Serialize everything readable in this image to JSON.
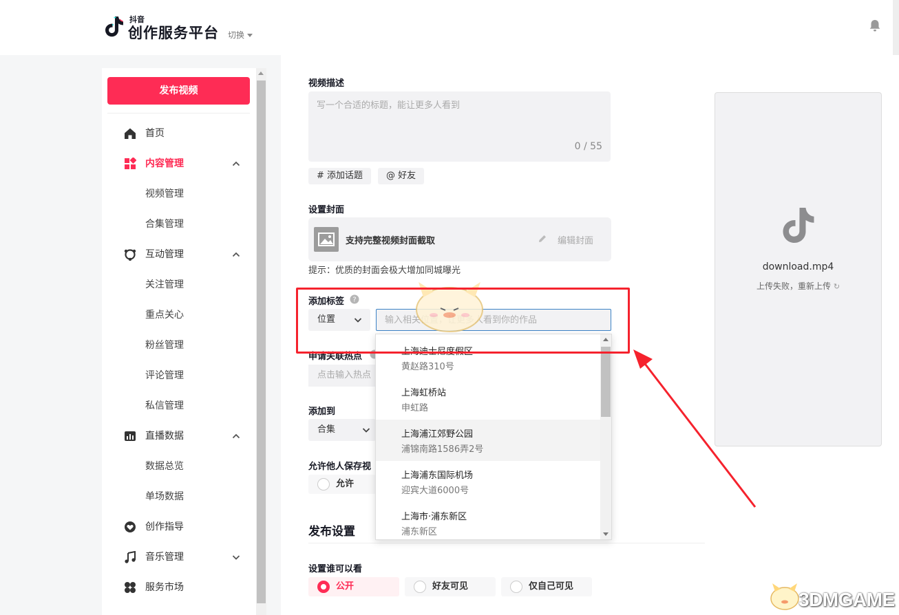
{
  "header": {
    "logo_small": "抖音",
    "logo_title": "创作服务平台",
    "switch_label": "切换"
  },
  "sidebar": {
    "publish_button": "发布视频",
    "items": [
      {
        "label": "首页",
        "icon": "home-icon"
      },
      {
        "label": "内容管理",
        "icon": "grid-icon",
        "active": true,
        "expanded": true
      },
      {
        "label": "视频管理"
      },
      {
        "label": "合集管理"
      },
      {
        "label": "互动管理",
        "icon": "interact-icon",
        "expanded": true
      },
      {
        "label": "关注管理"
      },
      {
        "label": "重点关心"
      },
      {
        "label": "粉丝管理"
      },
      {
        "label": "评论管理"
      },
      {
        "label": "私信管理"
      },
      {
        "label": "直播数据",
        "icon": "bar-chart-icon",
        "expanded": true
      },
      {
        "label": "数据总览"
      },
      {
        "label": "单场数据"
      },
      {
        "label": "创作指导",
        "icon": "heart-icon"
      },
      {
        "label": "音乐管理",
        "icon": "music-icon",
        "expanded": false
      },
      {
        "label": "服务市场",
        "icon": "clover-icon"
      }
    ]
  },
  "form": {
    "desc_label": "视频描述",
    "desc_placeholder": "写一个合适的标题，能让更多人看到",
    "desc_count": "0 / 55",
    "chip_topic": "# 添加话题",
    "chip_friend": "@ 好友",
    "cover_label": "设置封面",
    "cover_text": "支持完整视频封面截取",
    "cover_edit": "编辑封面",
    "cover_hint": "提示：优质的封面会极大增加同城曝光",
    "tag_label": "添加标签",
    "tag_type": "位置",
    "location_placeholder": "输入相关位置，让更多人看到你的作品",
    "hot_label": "申请关联热点",
    "hot_placeholder": "点击输入热点",
    "add_to_label": "添加到",
    "add_to_value": "合集",
    "allow_save_label": "允许他人保存视",
    "allow_option": "允许",
    "publish_section": "发布设置",
    "visibility_label": "设置谁可以看",
    "visibility_options": [
      "公开",
      "好友可见",
      "仅自己可见"
    ],
    "visibility_selected": "公开"
  },
  "location_dropdown": [
    {
      "name": "上海迪士尼度假区",
      "addr": "黄赵路310号"
    },
    {
      "name": "上海虹桥站",
      "addr": "申虹路"
    },
    {
      "name": "上海浦江郊野公园",
      "addr": "浦锦南路1586弄2号"
    },
    {
      "name": "上海浦东国际机场",
      "addr": "迎宾大道6000号"
    },
    {
      "name": "上海市·浦东新区",
      "addr": "浦东新区"
    }
  ],
  "preview": {
    "file_name": "download.mp4",
    "status": "上传失败，重新上传"
  },
  "watermark": "3DMGAME",
  "colors": {
    "accent": "#fe2c55",
    "annotation": "#f5222d",
    "input_focus": "#3b82c6"
  }
}
